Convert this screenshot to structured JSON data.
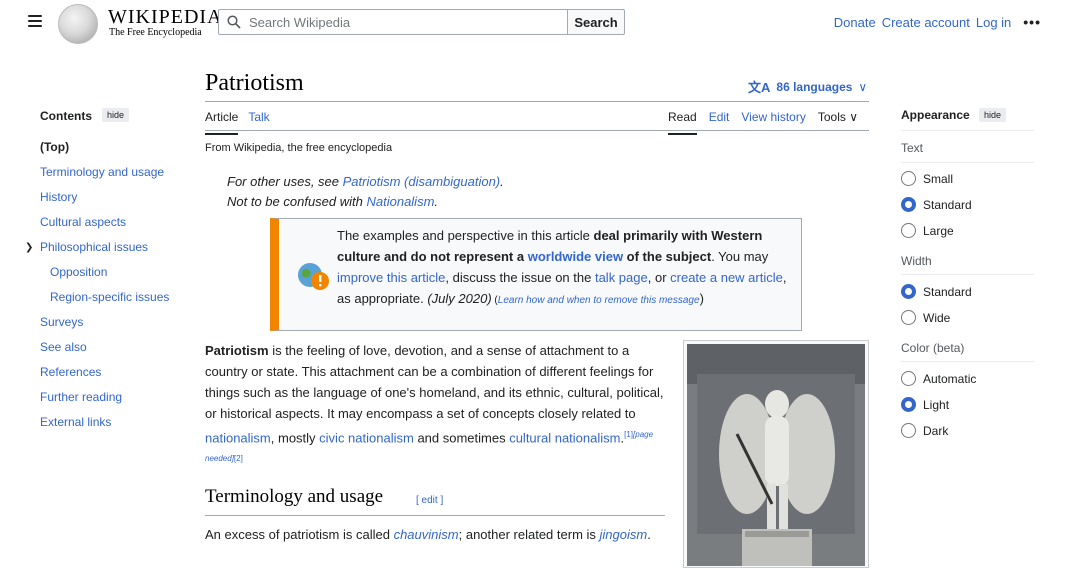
{
  "header": {
    "logo_word": "WIKIPEDIA",
    "logo_tagline": "The Free Encyclopedia",
    "search_placeholder": "Search Wikipedia",
    "search_button": "Search",
    "links": [
      "Donate",
      "Create account",
      "Log in"
    ],
    "more": "•••"
  },
  "toc": {
    "title": "Contents",
    "hide": "hide",
    "items": [
      "(Top)",
      "Terminology and usage",
      "History",
      "Cultural aspects",
      "Philosophical issues",
      "Opposition",
      "Region-specific issues",
      "Surveys",
      "See also",
      "References",
      "Further reading",
      "External links"
    ]
  },
  "article": {
    "title": "Patriotism",
    "languages": "86 languages",
    "tabs_left": [
      "Article",
      "Talk"
    ],
    "tabs_right": [
      "Read",
      "Edit",
      "View history",
      "Tools"
    ],
    "from": "From Wikipedia, the free encyclopedia",
    "hatnote": {
      "line1_prefix": "For other uses, see ",
      "line1_link": "Patriotism (disambiguation)",
      "line1_suffix": ".",
      "line2_prefix": "Not to be confused with ",
      "line2_link": "Nationalism",
      "line2_suffix": "."
    },
    "ambox": {
      "t1": "The examples and perspective in this article ",
      "b1": "deal primarily with Western culture and do not represent a ",
      "l1": "worldwide view",
      "b2": " of the subject",
      "t2": ". You may ",
      "l2": "improve this article",
      "t3": ", discuss the issue on the ",
      "l3": "talk page",
      "t4": ", or ",
      "l4": "create a new article",
      "t5": ", as appropriate. ",
      "date": "(July 2020)",
      "open": " (",
      "l5": "Learn how and when to remove this message",
      "close": ")"
    },
    "lead": {
      "bold": "Patriotism",
      "t1": " is the feeling of love, devotion, and a sense of attachment to a country or state. This attachment can be a combination of different feelings for things such as the language of one's homeland, and its ethnic, cultural, political, or historical aspects. It may encompass a set of concepts closely related to ",
      "l1": "nationalism",
      "t2": ", mostly ",
      "l2": "civic nationalism",
      "t3": " and sometimes ",
      "l3": "cultural nationalism",
      "t4": ".",
      "ref1": "[1]",
      "ref_needed": "[page needed]",
      "ref2": "[2]"
    },
    "section_title": "Terminology and usage",
    "section_edit": "[ edit ]",
    "para2": {
      "t1": "An excess of patriotism is called ",
      "l1": "chauvinism",
      "t2": "; another related term is ",
      "l2": "jingoism",
      "t3": "."
    }
  },
  "appearance": {
    "title": "Appearance",
    "hide": "hide",
    "text_label": "Text",
    "text_options": [
      "Small",
      "Standard",
      "Large"
    ],
    "text_selected": "Standard",
    "width_label": "Width",
    "width_options": [
      "Standard",
      "Wide"
    ],
    "width_selected": "Standard",
    "color_label": "Color (beta)",
    "color_options": [
      "Automatic",
      "Light",
      "Dark"
    ],
    "color_selected": "Light"
  },
  "colors": {
    "link": "#3366cc",
    "ambox_stripe": "#f28500"
  }
}
